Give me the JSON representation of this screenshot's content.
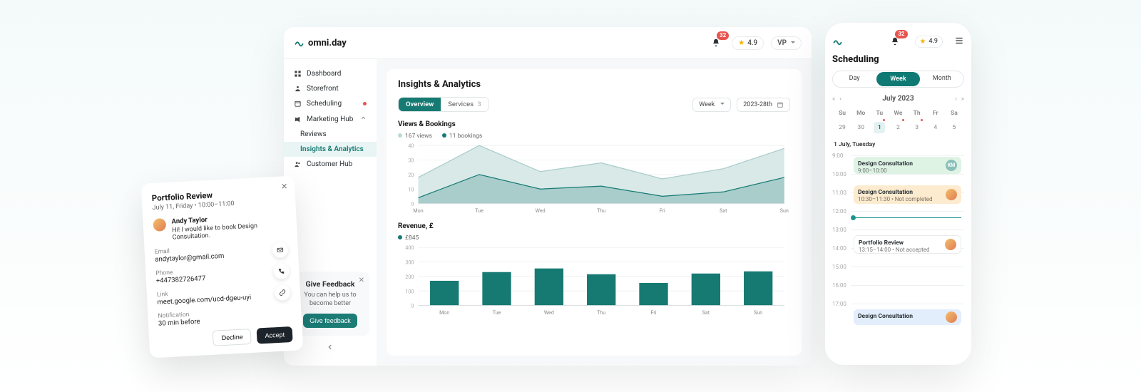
{
  "colors": {
    "teal": "#167a73",
    "tealDark": "#0f7a74",
    "red": "#e8534e",
    "star": "#f5b301"
  },
  "header": {
    "brand": "omni.day",
    "notif_count": "32",
    "rating": "4.9",
    "user_initials": "VP"
  },
  "sidebar": {
    "items": [
      {
        "label": "Dashboard"
      },
      {
        "label": "Storefront"
      },
      {
        "label": "Scheduling",
        "dot": true
      },
      {
        "label": "Marketing Hub",
        "expanded": true
      },
      {
        "label": "Reviews",
        "sub": true
      },
      {
        "label": "Insights & Analytics",
        "sub": true,
        "active": true
      },
      {
        "label": "Customer Hub"
      }
    ],
    "feedback": {
      "title": "Give Feedback",
      "body": "You can help us to become better",
      "button": "Give feedback"
    }
  },
  "analytics": {
    "title": "Insights & Analytics",
    "tabs": {
      "overview": "Overview",
      "services_label": "Services",
      "services_count": "3"
    },
    "range": {
      "granularity": "Week",
      "period": "2023-28th"
    },
    "views_title": "Views & Bookings",
    "views_legend_a": "167 views",
    "views_legend_b": "11 bookings",
    "revenue_title": "Revenue, £",
    "revenue_legend": "£845"
  },
  "chart_data": [
    {
      "type": "area",
      "title": "Views & Bookings",
      "categories": [
        "Mon",
        "Tue",
        "Wed",
        "Thu",
        "Fri",
        "Sat",
        "Sun"
      ],
      "series": [
        {
          "name": "views",
          "values": [
            18,
            40,
            22,
            28,
            17,
            24,
            38
          ]
        },
        {
          "name": "bookings",
          "values": [
            4,
            20,
            10,
            12,
            5,
            8,
            18
          ]
        }
      ],
      "ylim": [
        0,
        40
      ],
      "yticks": [
        0,
        10,
        20,
        30,
        40
      ],
      "xlabel": "",
      "ylabel": ""
    },
    {
      "type": "bar",
      "title": "Revenue, £",
      "categories": [
        "Mon",
        "Tue",
        "Wed",
        "Thu",
        "Fri",
        "Sat",
        "Sun"
      ],
      "values": [
        170,
        230,
        255,
        215,
        155,
        220,
        235
      ],
      "ylim": [
        0,
        400
      ],
      "yticks": [
        0,
        100,
        200,
        300,
        400
      ],
      "xlabel": "",
      "ylabel": "£"
    }
  ],
  "modal": {
    "title": "Portfolio Review",
    "subtitle": "July 11, Friday • 10:00–11:00",
    "person_name": "Andy Taylor",
    "person_msg": "Hi! I would like to book Design Consultation.",
    "email_label": "Email",
    "email_val": "andytaylor@gmail.com",
    "phone_label": "Phone",
    "phone_val": "+447382726477",
    "link_label": "Link",
    "link_val": "meet.google.com/ucd-dgeu-uyi",
    "notif_label": "Notification",
    "notif_val": "30 min before",
    "decline": "Decline",
    "accept": "Accept"
  },
  "phone": {
    "notif_count": "32",
    "rating": "4.9",
    "title": "Scheduling",
    "tabs": {
      "day": "Day",
      "week": "Week",
      "month": "Month"
    },
    "month_label": "July 2023",
    "weekdays": [
      "Su",
      "Mo",
      "Tu",
      "We",
      "Th",
      "Fr",
      "Sa"
    ],
    "row": [
      "29",
      "30",
      "1",
      "2",
      "3",
      "4",
      "5"
    ],
    "selected_index": 2,
    "date_caption": "1 July, Tuesday",
    "hours": [
      "9:00",
      "10:00",
      "11:00",
      "12:00",
      "13:00",
      "14:00",
      "15:00",
      "16:00",
      "17:00"
    ],
    "events": [
      {
        "title": "Design Consultation",
        "meta": "9:00–10:00",
        "status": "",
        "class": "ev-green",
        "top": 8,
        "height": 24,
        "avatar_text": "KM"
      },
      {
        "title": "Design Consultation",
        "meta": "10:30–11:30 • Not completed",
        "class": "ev-orange",
        "top": 48,
        "height": 26,
        "avatar_text": ""
      },
      {
        "title": "Portfolio Review",
        "meta": "13:15–14:00 • Not accepted",
        "class": "ev-white",
        "top": 118,
        "height": 26,
        "avatar_text": ""
      },
      {
        "title": "Design Consultation",
        "meta": "",
        "class": "ev-blue",
        "top": 222,
        "height": 22,
        "avatar_text": ""
      }
    ]
  }
}
